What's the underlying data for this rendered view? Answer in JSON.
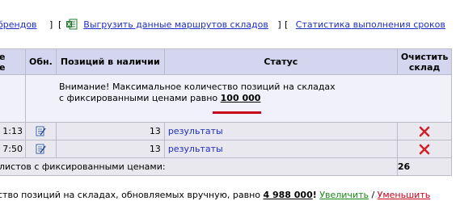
{
  "topbar": {
    "link1": "брендов",
    "bracket_close1": "]",
    "bracket_open2": "[",
    "link2": "Выгрузить данные маршрутов складов",
    "bracket_close2": "]",
    "bracket_open3": "[",
    "link3": "Статистика выполнения сроков"
  },
  "table": {
    "headers": {
      "col0": "е\nе",
      "col1": "Обн.",
      "col2": "Позиций в наличии",
      "col3": "Статус",
      "col4": "Очистить склад"
    },
    "notice": {
      "line1": "Внимание! Максимальное количество позиций на складах",
      "line2_prefix": "с фиксированными ценами равно ",
      "max_value": "100 000"
    },
    "rows": [
      {
        "time": "1:13",
        "count": "13",
        "status_link": "результаты"
      },
      {
        "time": "7:50",
        "count": "13",
        "status_link": "результаты"
      }
    ],
    "summary": {
      "label": "листов с фиксированными ценами:",
      "value": "26"
    }
  },
  "footer": {
    "prefix": "ство позиций на складах, обновляемых вручную, равно ",
    "value": "4 988 000",
    "after_value": "!",
    "increase": "Увеличить",
    "sep": " / ",
    "decrease": "Уменьшить"
  },
  "colors": {
    "link": "#1f2ec4",
    "header_bg": "#d4d6ef",
    "row_bg": "#e8e8ee",
    "accent_red": "#c7001c",
    "increase_green": "#1a8a1a"
  }
}
